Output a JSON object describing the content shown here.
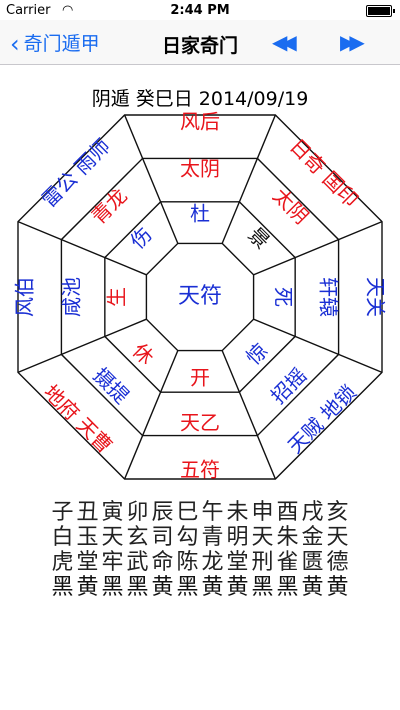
{
  "status_bar": {
    "carrier": "Carrier",
    "time": "2:44 PM"
  },
  "nav": {
    "back_label": "奇门遁甲",
    "title": "日家奇门"
  },
  "date_line": "阴遁 癸巳日 2014/09/19",
  "colors": {
    "red": "#e8141b",
    "blue": "#1a2fd4",
    "black": "#111111",
    "accent": "#1a6cf0"
  },
  "center": {
    "text": "天符",
    "color": "blue"
  },
  "palaces": [
    {
      "dir": "S",
      "inner": {
        "text": "杜",
        "color": "blue"
      },
      "middle": {
        "text": "太阴",
        "color": "red"
      },
      "outer": {
        "text": "风后",
        "color": "red"
      }
    },
    {
      "dir": "SW",
      "inner": {
        "text": "景",
        "color": "black"
      },
      "middle": {
        "text": "太阴",
        "color": "red"
      },
      "outer": {
        "text": "日奇 国印",
        "color": "red"
      }
    },
    {
      "dir": "W",
      "inner": {
        "text": "死",
        "color": "blue"
      },
      "middle": {
        "text": "轩辕",
        "color": "blue"
      },
      "outer": {
        "text": "天关",
        "color": "blue"
      }
    },
    {
      "dir": "NW",
      "inner": {
        "text": "惊",
        "color": "blue"
      },
      "middle": {
        "text": "招摇",
        "color": "blue"
      },
      "outer": {
        "text": "天贼 地锁",
        "color": "blue"
      }
    },
    {
      "dir": "N",
      "inner": {
        "text": "开",
        "color": "red"
      },
      "middle": {
        "text": "天乙",
        "color": "red"
      },
      "outer": {
        "text": "五符",
        "color": "red"
      }
    },
    {
      "dir": "NE",
      "inner": {
        "text": "休",
        "color": "red"
      },
      "middle": {
        "text": "摄提",
        "color": "blue"
      },
      "outer": {
        "text": "地府 天曹",
        "color": "red"
      }
    },
    {
      "dir": "E",
      "inner": {
        "text": "生",
        "color": "red"
      },
      "middle": {
        "text": "咸池",
        "color": "blue"
      },
      "outer": {
        "text": "风伯",
        "color": "blue"
      }
    },
    {
      "dir": "SE",
      "inner": {
        "text": "伤",
        "color": "blue"
      },
      "middle": {
        "text": "青龙",
        "color": "red"
      },
      "outer": {
        "text": "雷公 雨师",
        "color": "blue"
      }
    }
  ],
  "table": {
    "rows": [
      [
        "子",
        "丑",
        "寅",
        "卯",
        "辰",
        "巳",
        "午",
        "未",
        "申",
        "酉",
        "戌",
        "亥"
      ],
      [
        "白",
        "玉",
        "天",
        "玄",
        "司",
        "勾",
        "青",
        "明",
        "天",
        "朱",
        "金",
        "天"
      ],
      [
        "虎",
        "堂",
        "牢",
        "武",
        "命",
        "陈",
        "龙",
        "堂",
        "刑",
        "雀",
        "匮",
        "德"
      ],
      [
        "黑",
        "黄",
        "黑",
        "黑",
        "黄",
        "黑",
        "黄",
        "黄",
        "黑",
        "黑",
        "黄",
        "黄"
      ]
    ]
  }
}
